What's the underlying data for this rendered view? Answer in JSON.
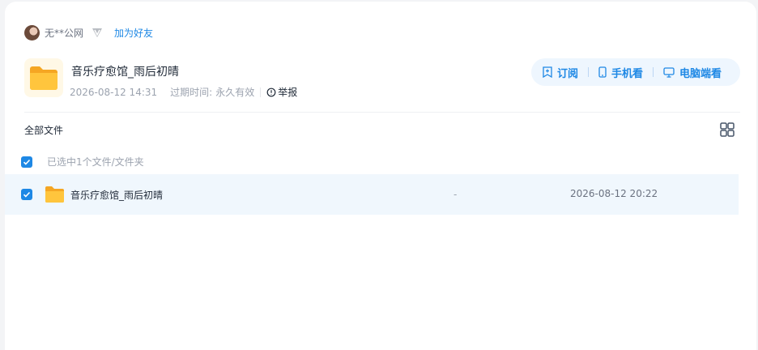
{
  "user": {
    "name": "无**公网",
    "vip_icon": "diamond-icon",
    "add_friend_label": "加为好友"
  },
  "share": {
    "title": "音乐疗愈馆_雨后初晴",
    "created": "2026-08-12 14:31",
    "expiry_label": "过期时间:",
    "expiry_value": "永久有效",
    "report_label": "举报"
  },
  "actions": {
    "subscribe": "订阅",
    "mobile": "手机看",
    "desktop": "电脑端看"
  },
  "files": {
    "header": "全部文件",
    "selected_summary": "已选中1个文件/文件夹",
    "rows": [
      {
        "name": "音乐疗愈馆_雨后初晴",
        "size": "-",
        "date": "2026-08-12 20:22",
        "checked": true
      }
    ]
  },
  "colors": {
    "accent": "#1e88e5",
    "folder": "#ffc53d",
    "row_highlight": "#f0f7fd"
  }
}
